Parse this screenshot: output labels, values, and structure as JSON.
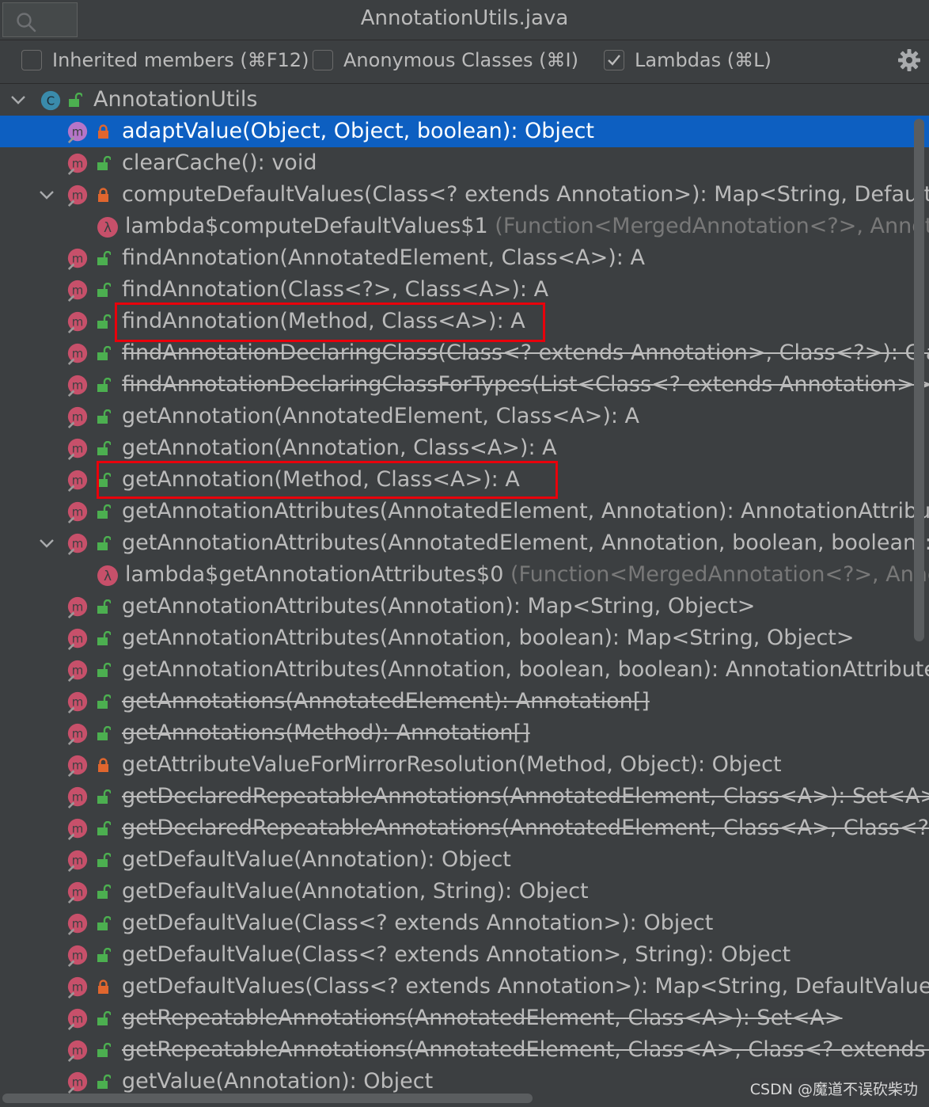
{
  "window": {
    "title": "AnnotationUtils.java"
  },
  "icons": {
    "search": "search-icon",
    "settings": "gear-icon",
    "method": "method-icon",
    "lambda": "lambda-icon",
    "class": "class-icon",
    "lock": "lock-icon",
    "expand": "chevron-down-icon"
  },
  "colors": {
    "selection": "#0d5fc1",
    "highlight_box": "#e8000b",
    "method_icon": "#c7506a",
    "public_lock": "#4caf50",
    "private_lock": "#e0662e"
  },
  "filters": {
    "inherited": {
      "label": "Inherited members (⌘F12)",
      "checked": false
    },
    "anonymous": {
      "label": "Anonymous Classes (⌘I)",
      "checked": false
    },
    "lambdas": {
      "label": "Lambdas (⌘L)",
      "checked": true
    }
  },
  "tree": {
    "root": {
      "label": "AnnotationUtils",
      "icon_letter": "C"
    },
    "items": [
      {
        "text": "adaptValue(Object, Object, boolean): Object"
      },
      {
        "text": "clearCache(): void"
      },
      {
        "text": "computeDefaultValues(Class<? extends Annotation>): Map<String, DefaultV"
      },
      {
        "text": "lambda$computeDefaultValues$1",
        "sig": "(Function<MergedAnnotation<?>, Annota"
      },
      {
        "text": "findAnnotation(AnnotatedElement, Class<A>): A"
      },
      {
        "text": "findAnnotation(Class<?>, Class<A>): A"
      },
      {
        "text": "findAnnotation(Method, Class<A>): A"
      },
      {
        "text": "findAnnotationDeclaringClass(Class<? extends Annotation>, Class<?>): Cla"
      },
      {
        "text": "findAnnotationDeclaringClassForTypes(List<Class<? extends Annotation>>"
      },
      {
        "text": "getAnnotation(AnnotatedElement, Class<A>): A"
      },
      {
        "text": "getAnnotation(Annotation, Class<A>): A"
      },
      {
        "text": "getAnnotation(Method, Class<A>): A"
      },
      {
        "text": "getAnnotationAttributes(AnnotatedElement, Annotation): AnnotationAttribu"
      },
      {
        "text": "getAnnotationAttributes(AnnotatedElement, Annotation, boolean, boolean):"
      },
      {
        "text": "lambda$getAnnotationAttributes$0",
        "sig": "(Function<MergedAnnotation<?>, Anno"
      },
      {
        "text": "getAnnotationAttributes(Annotation): Map<String, Object>"
      },
      {
        "text": "getAnnotationAttributes(Annotation, boolean): Map<String, Object>"
      },
      {
        "text": "getAnnotationAttributes(Annotation, boolean, boolean): AnnotationAttribute"
      },
      {
        "text": "getAnnotations(AnnotatedElement): Annotation[]"
      },
      {
        "text": "getAnnotations(Method): Annotation[]"
      },
      {
        "text": "getAttributeValueForMirrorResolution(Method, Object): Object"
      },
      {
        "text": "getDeclaredRepeatableAnnotations(AnnotatedElement, Class<A>): Set<A>"
      },
      {
        "text": "getDeclaredRepeatableAnnotations(AnnotatedElement, Class<A>, Class<? e"
      },
      {
        "text": "getDefaultValue(Annotation): Object"
      },
      {
        "text": "getDefaultValue(Annotation, String): Object"
      },
      {
        "text": "getDefaultValue(Class<? extends Annotation>): Object"
      },
      {
        "text": "getDefaultValue(Class<? extends Annotation>, String): Object"
      },
      {
        "text": "getDefaultValues(Class<? extends Annotation>): Map<String, DefaultValue"
      },
      {
        "text": "getRepeatableAnnotations(AnnotatedElement, Class<A>): Set<A>"
      },
      {
        "text": "getRepeatableAnnotations(AnnotatedElement, Class<A>, Class<? extends A"
      },
      {
        "text": "getValue(Annotation): Object"
      }
    ]
  },
  "watermark": "CSDN @魔道不误砍柴功"
}
